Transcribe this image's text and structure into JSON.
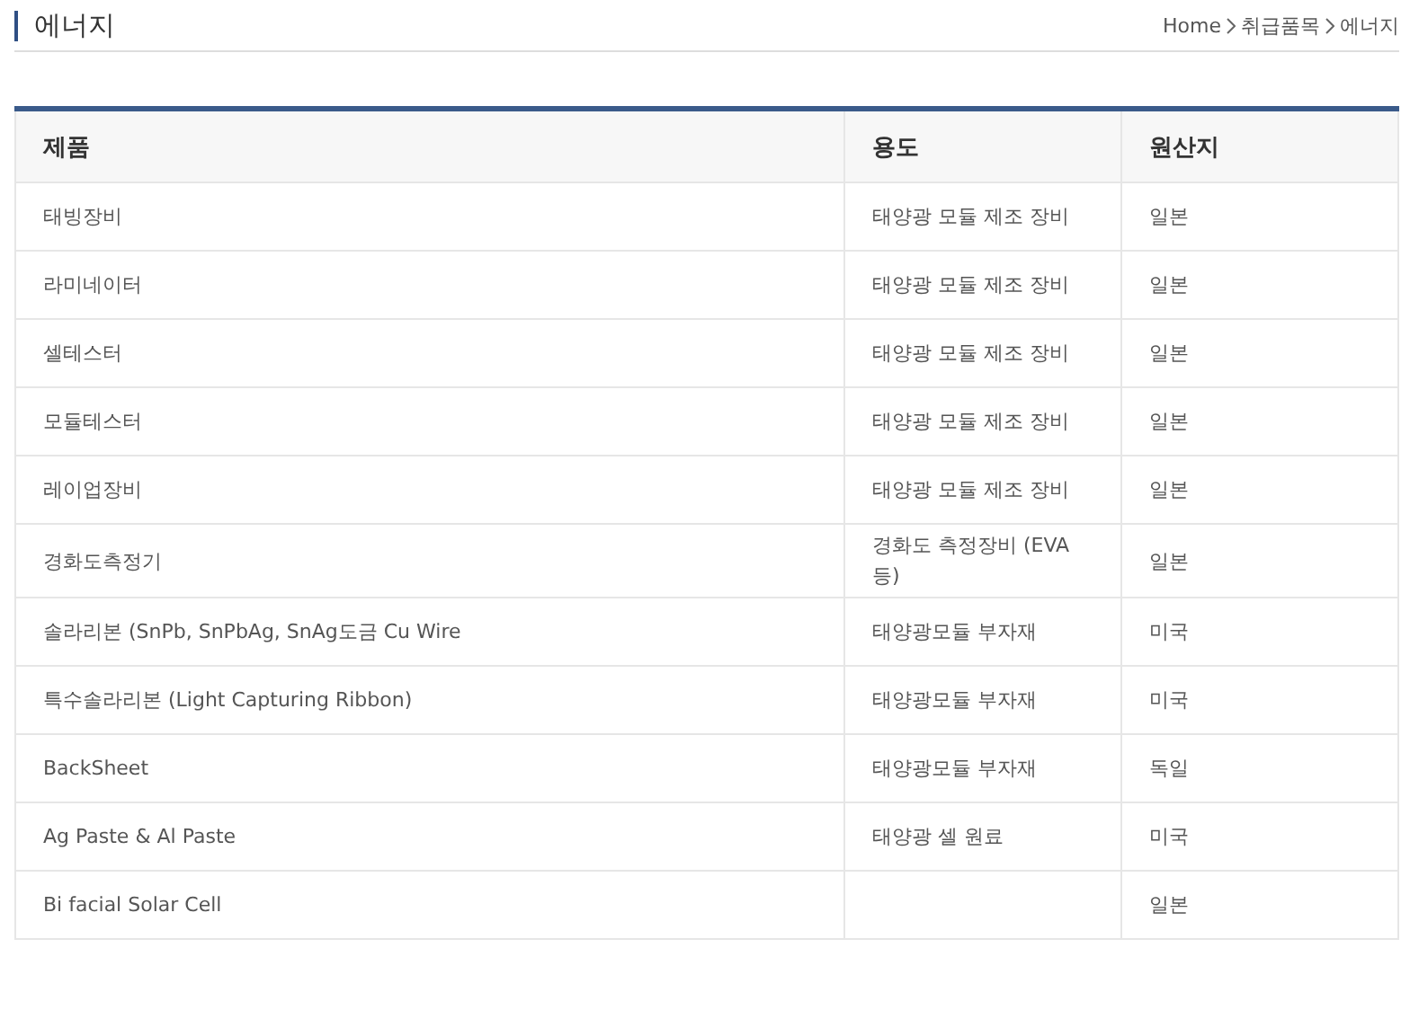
{
  "page_title": "에너지",
  "breadcrumb": [
    "Home",
    "취급품목",
    "에너지"
  ],
  "table": {
    "columns": [
      "제품",
      "용도",
      "원산지"
    ],
    "rows": [
      [
        "태빙장비",
        "태양광 모듈 제조 장비",
        "일본"
      ],
      [
        "라미네이터",
        "태양광 모듈 제조 장비",
        "일본"
      ],
      [
        "셀테스터",
        "태양광 모듈 제조 장비",
        "일본"
      ],
      [
        "모듈테스터",
        "태양광 모듈 제조 장비",
        "일본"
      ],
      [
        "레이업장비",
        "태양광 모듈 제조 장비",
        "일본"
      ],
      [
        "경화도측정기",
        "경화도 측정장비 (EVA 등)",
        "일본"
      ],
      [
        "솔라리본 (SnPb, SnPbAg, SnAg도금 Cu Wire",
        "태양광모듈 부자재",
        "미국"
      ],
      [
        "특수솔라리본 (Light Capturing Ribbon)",
        "태양광모듈 부자재",
        "미국"
      ],
      [
        "BackSheet",
        "태양광모듈 부자재",
        "독일"
      ],
      [
        "Ag Paste & Al Paste",
        "태양광 셀 원료",
        "미국"
      ],
      [
        "Bi facial Solar Cell",
        "",
        "일본"
      ]
    ]
  }
}
